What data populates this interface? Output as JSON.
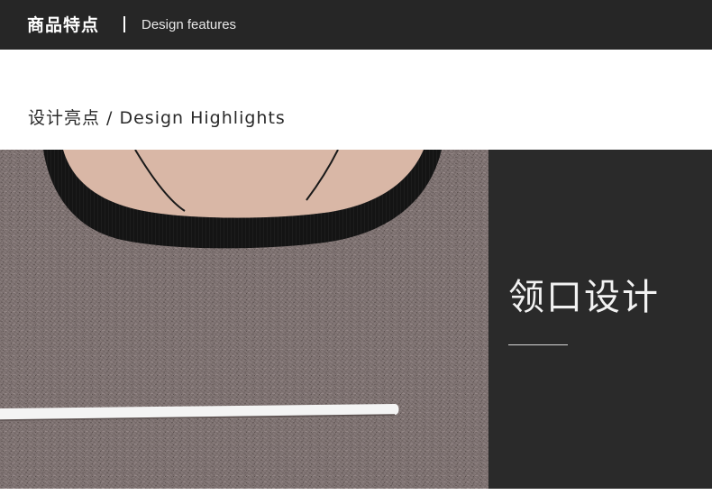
{
  "header": {
    "title": "商品特点",
    "subtitle": "Design features"
  },
  "section": {
    "heading": "设计亮点 / Design Highlights"
  },
  "panel": {
    "title": "领口设计"
  },
  "colors": {
    "header_bg": "#262626",
    "panel_bg": "#2a2a2a",
    "fabric": "#7e7170",
    "collar": "#141414",
    "trim": "#f4f4f4"
  }
}
